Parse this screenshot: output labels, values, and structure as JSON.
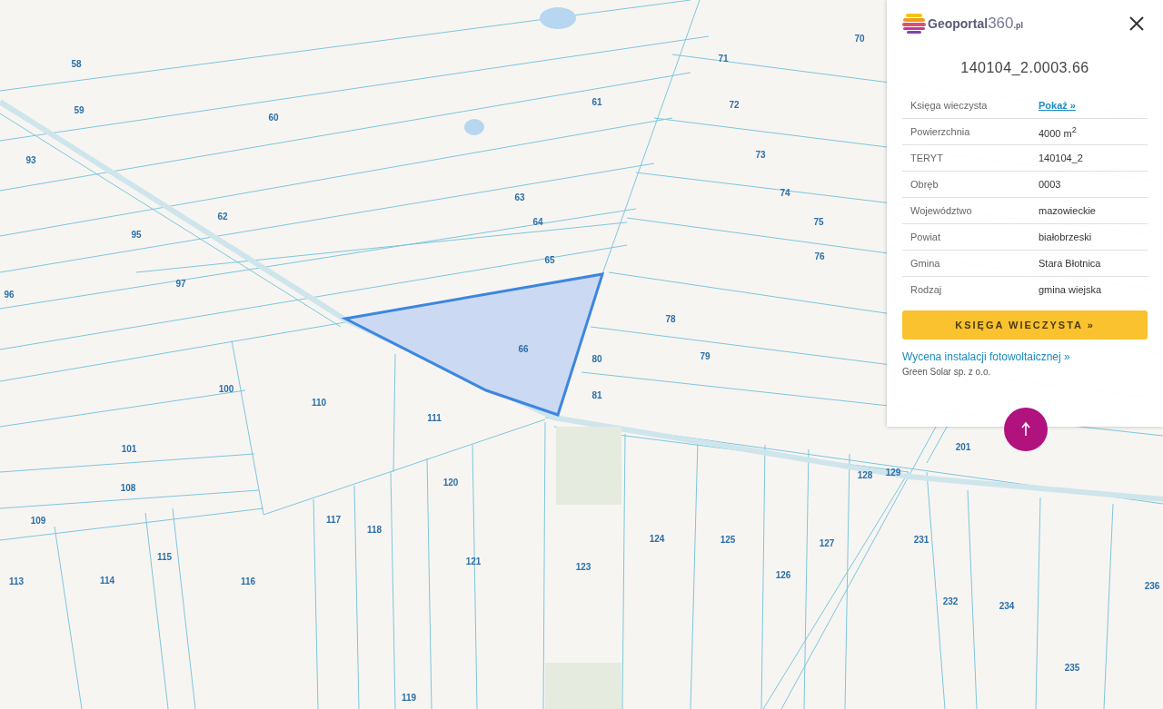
{
  "map": {
    "parcel_labels": [
      "58",
      "59",
      "60",
      "61",
      "70",
      "71",
      "72",
      "73",
      "74",
      "75",
      "76",
      "93",
      "95",
      "62",
      "63",
      "64",
      "65",
      "96",
      "97",
      "78",
      "66",
      "80",
      "79",
      "81",
      "100",
      "110",
      "111",
      "101",
      "108",
      "109",
      "120",
      "117",
      "118",
      "113",
      "114",
      "115",
      "116",
      "121",
      "123",
      "124",
      "125",
      "126",
      "127",
      "128",
      "129",
      "201",
      "231",
      "232",
      "234",
      "235",
      "236",
      "119"
    ]
  },
  "panel": {
    "logo": {
      "name": "Geoportal",
      "number": "360",
      "suffix": ".pl"
    },
    "title": "140104_2.0003.66",
    "rows": [
      {
        "label": "Księga wieczysta",
        "value": "Pokaż »",
        "kind": "link"
      },
      {
        "label": "Powierzchnia",
        "value": "4000 m$^{2}$",
        "kind": "text"
      },
      {
        "label": "TERYT",
        "value": "140104_2",
        "kind": "text"
      },
      {
        "label": "Obręb",
        "value": "0003",
        "kind": "text"
      },
      {
        "label": "Województwo",
        "value": "mazowieckie",
        "kind": "text"
      },
      {
        "label": "Powiat",
        "value": "białobrzeski",
        "kind": "text"
      },
      {
        "label": "Gmina",
        "value": "Stara Błotnica",
        "kind": "text"
      },
      {
        "label": "Rodzaj",
        "value": "gmina wiejska",
        "kind": "text"
      }
    ],
    "button": "KSIĘGA WIECZYSTA »",
    "promo_link": "Wycena instalacji fotowoltaicznej »",
    "promo_company": "Green Solar sp. z o.o."
  }
}
